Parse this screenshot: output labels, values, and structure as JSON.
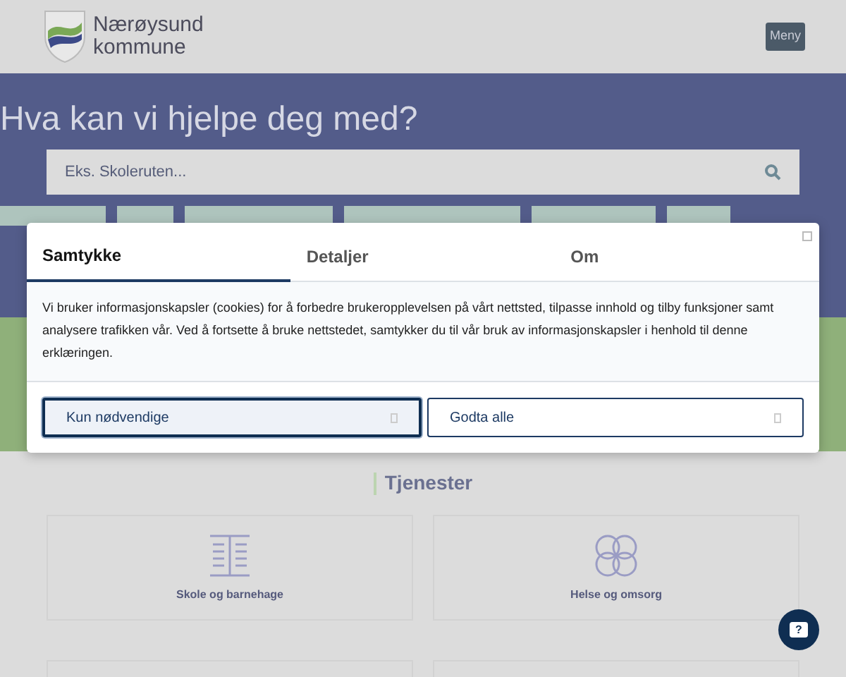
{
  "header": {
    "logo_text": [
      "Nærøysund",
      "kommune"
    ],
    "menu_button": "Meny"
  },
  "hero": {
    "title": "Hva kan vi hjelpe deg med?",
    "search": {
      "placeholder": "Eks. Skoleruten..."
    }
  },
  "services": {
    "title": "Tjenester",
    "cards": [
      {
        "label": "Skole og barnehage",
        "kind": "book"
      },
      {
        "label": "Helse og omsorg",
        "kind": "rings"
      }
    ]
  },
  "cookie_dialog": {
    "tabs": [
      {
        "label": "Samtykke",
        "selected": true
      },
      {
        "label": "Detaljer",
        "selected": false
      },
      {
        "label": "Om",
        "selected": false
      }
    ],
    "text": "Vi bruker informasjonskapsler (cookies) for å forbedre brukeropplevelsen på vårt nettsted, tilpasse innhold og tilby funksjoner samt analysere trafikken vår. Ved å fortsette å bruke nettstedet, samtykker du til vår bruk av informasjonskapsler i henhold til denne erklæringen.",
    "buttons": [
      {
        "label": "Kun nødvendige",
        "selected": true
      },
      {
        "label": "Godta alle",
        "selected": false
      }
    ]
  },
  "chat_button": "?"
}
